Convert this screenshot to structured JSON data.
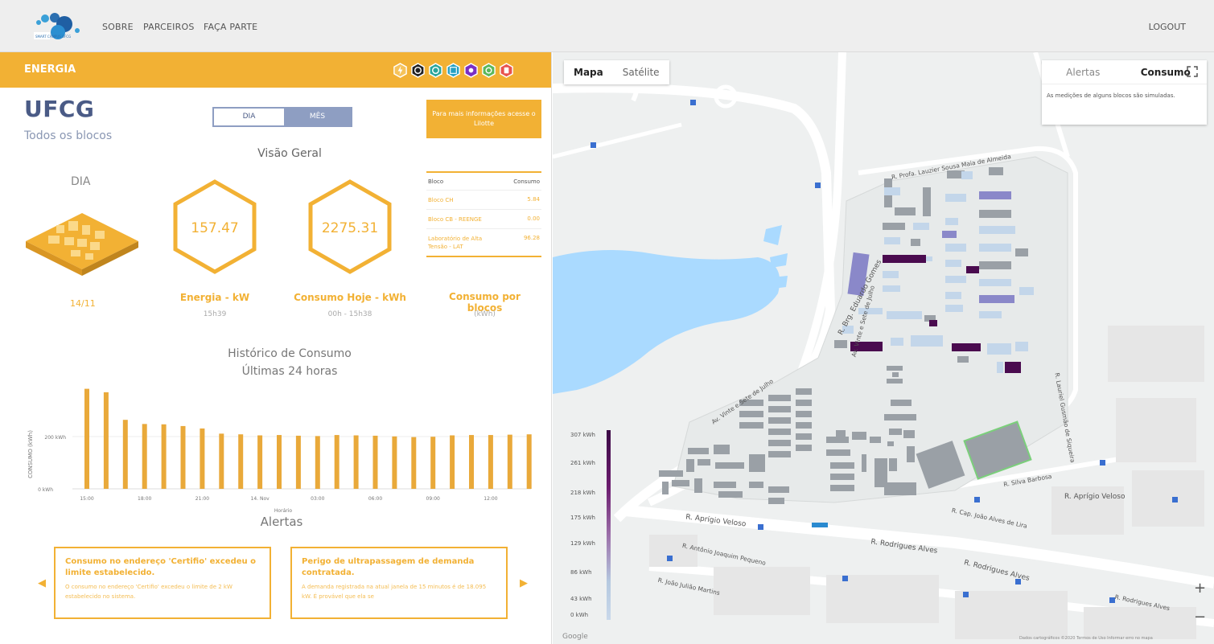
{
  "nav": {
    "items": [
      "SOBRE",
      "PARCEIROS",
      "FAÇA PARTE"
    ],
    "logout": "LOGOUT",
    "logo_text": "SMART CAMPUS UFCG"
  },
  "energy_bar": {
    "title": "ENERGIA",
    "category_icons": [
      {
        "name": "energy-icon",
        "color": "#f2b134"
      },
      {
        "name": "water-drop-icon",
        "color": "#222222"
      },
      {
        "name": "recycle-icon",
        "color": "#2aa69b"
      },
      {
        "name": "gas-icon",
        "color": "#26a0c4"
      },
      {
        "name": "air-icon",
        "color": "#7a2fc4"
      },
      {
        "name": "gear-icon",
        "color": "#5bb85b"
      },
      {
        "name": "alert-icon",
        "color": "#e8534f"
      }
    ]
  },
  "campus": {
    "name": "UFCG",
    "subtitle": "Todos os blocos"
  },
  "toggle": {
    "dia": "DIA",
    "mes": "MÊS"
  },
  "info_button": "Para mais informações acesse o Lilotte",
  "overview": {
    "title": "Visão Geral",
    "period_label": "DIA",
    "date": "14/11",
    "energy": {
      "value": "157.47",
      "label": "Energia - kW",
      "sub": "15h39"
    },
    "consumption": {
      "value": "2275.31",
      "label": "Consumo Hoje - kWh",
      "sub": "00h - 15h38"
    }
  },
  "block_table": {
    "headers": [
      "Bloco",
      "Consumo"
    ],
    "rows": [
      {
        "name": "Bloco CH",
        "value": "5.84"
      },
      {
        "name": "Bloco CB - REENGE",
        "value": "0.00"
      },
      {
        "name": "Laboratório de Alta Tensão - LAT",
        "value": "96.28"
      }
    ],
    "title": "Consumo por blocos",
    "unit": "(kWh)"
  },
  "history": {
    "title": "Histórico de Consumo",
    "subtitle": "Últimas 24 horas"
  },
  "chart_data": {
    "type": "bar",
    "title": "Histórico de Consumo Últimas 24 horas",
    "xlabel": "Horário",
    "ylabel": "CONSUMO (kWh)",
    "yticks": [
      "0 kWh",
      "200 kWh"
    ],
    "xticks": [
      "15:00",
      "18:00",
      "21:00",
      "14. Nov",
      "03:00",
      "06:00",
      "09:00",
      "12:00"
    ],
    "ylim": [
      0,
      310
    ],
    "values": [
      290,
      280,
      200,
      188,
      187,
      182,
      175,
      160,
      158,
      155,
      156,
      154,
      153,
      156,
      155,
      154,
      152,
      150,
      151,
      155,
      156,
      156,
      157,
      158
    ],
    "color": "#e9a93a",
    "grid": true
  },
  "alerts": {
    "title": "Alertas",
    "cards": [
      {
        "headline": "Consumo no endereço 'Certifio' excedeu o limite estabelecido.",
        "body": "O consumo no endereço 'Certifio' excedeu o limite de 2 kW estabelecido no sistema."
      },
      {
        "headline": "Perigo de ultrapassagem de demanda contratada.",
        "body": "A demanda registrada na atual janela de 15 minutos é de 18.095 kW. É provável que ela se"
      }
    ]
  },
  "map": {
    "type_buttons": [
      "Mapa",
      "Satélite"
    ],
    "layer_tabs": [
      "Alertas",
      "Consumo"
    ],
    "note": "As medições de alguns blocos são simuladas.",
    "legend": [
      "307 kWh",
      "261 kWh",
      "218 kWh",
      "175 kWh",
      "129 kWh",
      "86 kWh",
      "43 kWh",
      "0 kWh"
    ],
    "streets": [
      "R. Brg. Eduardo Gomes",
      "Av. Vinte e Sete de Julho",
      "R. Aprígio Veloso",
      "R. Rodrigues Alves",
      "R. Silva Barbosa",
      "R. Cap. João Alves de Lira",
      "R. Antônio Joaquim Pequeno",
      "R. João Julião Martins",
      "R. Profa. Lauzier Sousa Maia de Almeida",
      "R. Lauriel Gusmão de Siqueira",
      "R. Rodrigues Alves",
      "R. Aprígio Veloso"
    ],
    "attribution": "Google",
    "footer": "Dados cartográficos ©2020   Termos de Uso   Informar erro no mapa",
    "zoom_in": "+",
    "zoom_out": "−"
  }
}
